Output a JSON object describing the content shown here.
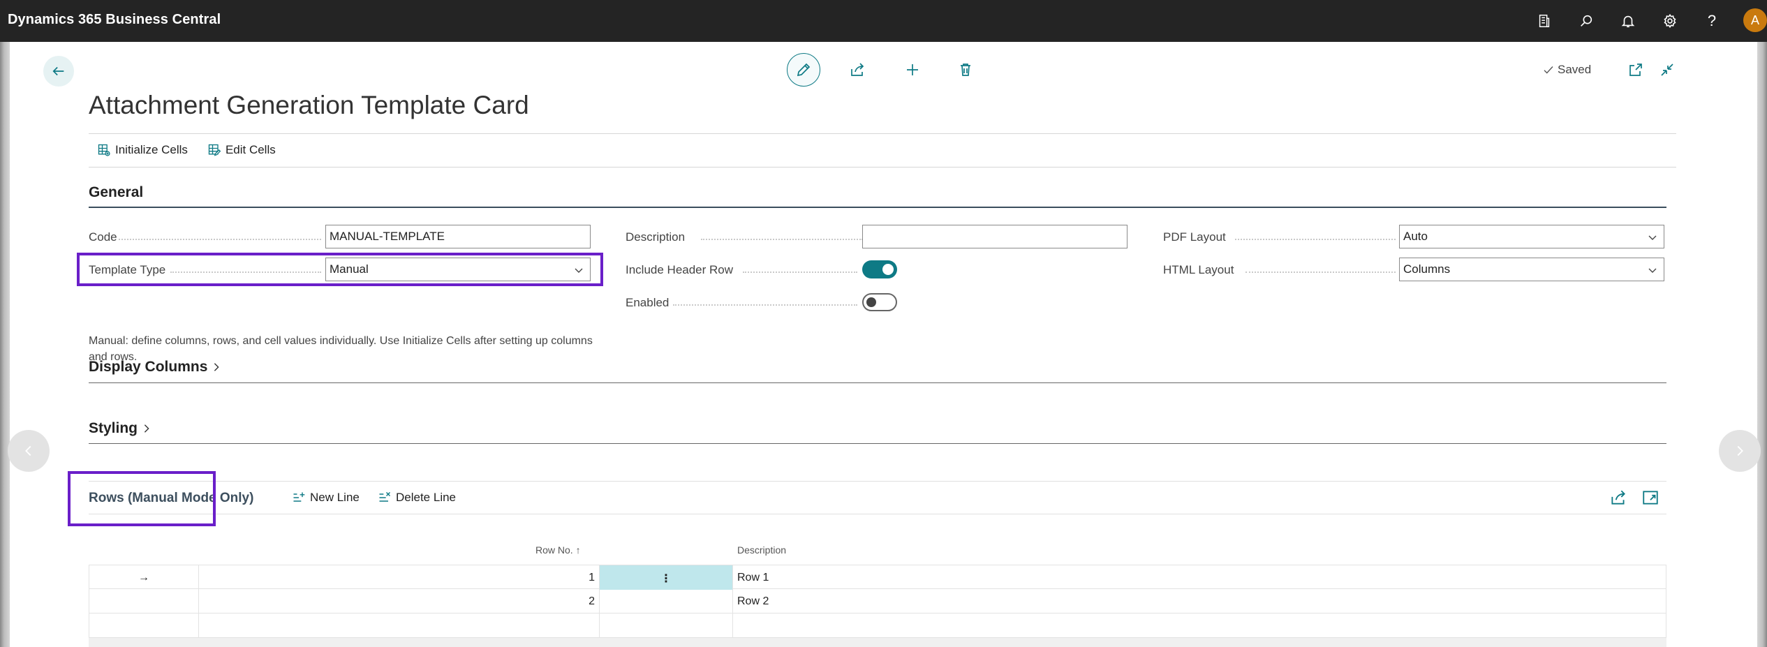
{
  "app": {
    "title": "Dynamics 365 Business Central",
    "user_initial": "A"
  },
  "topbar_icons": [
    "report-icon",
    "search-icon",
    "bell-icon",
    "gear-icon",
    "help-icon"
  ],
  "help_glyph": "?",
  "header": {
    "saved_label": "Saved",
    "title": "Attachment Generation Template Card"
  },
  "actions": {
    "initialize_cells": "Initialize Cells",
    "edit_cells": "Edit Cells"
  },
  "general": {
    "heading": "General",
    "code_label": "Code",
    "code_value": "MANUAL-TEMPLATE",
    "template_type_label": "Template Type",
    "template_type_value": "Manual",
    "help_text": "Manual: define columns, rows, and cell values individually. Use Initialize Cells after setting up columns and rows.",
    "description_label": "Description",
    "description_value": "",
    "include_header_row_label": "Include Header Row",
    "include_header_row": true,
    "enabled_label": "Enabled",
    "enabled": false,
    "pdf_layout_label": "PDF Layout",
    "pdf_layout_value": "Auto",
    "html_layout_label": "HTML Layout",
    "html_layout_value": "Columns"
  },
  "display_columns": {
    "heading": "Display Columns"
  },
  "styling": {
    "heading": "Styling"
  },
  "rows_part": {
    "title": "Rows (Manual Mode Only)",
    "new_line": "New Line",
    "delete_line": "Delete Line",
    "col_row_no": "Row No. ↑",
    "col_description": "Description",
    "rows": [
      {
        "indicator": "→",
        "row_no": "1",
        "description": "Row 1"
      },
      {
        "indicator": "",
        "row_no": "2",
        "description": "Row 2"
      },
      {
        "indicator": "",
        "row_no": "",
        "description": ""
      }
    ]
  },
  "colors": {
    "accent": "#0e7a85",
    "highlight": "#6a1fc9",
    "topbar": "#242424"
  }
}
